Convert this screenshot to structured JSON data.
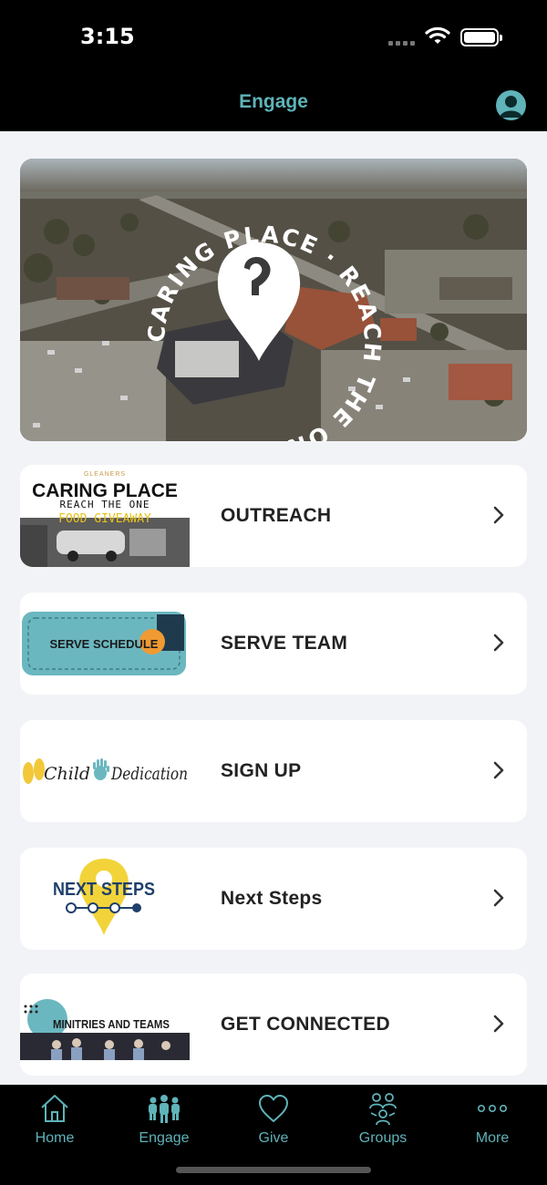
{
  "status_bar": {
    "time": "3:15"
  },
  "header": {
    "title": "Engage",
    "profile_icon": "person-circle-icon"
  },
  "hero": {
    "ring_text": "CARING PLACE · REACH THE ONE ·"
  },
  "cards": [
    {
      "label": "OUTREACH",
      "thumb": {
        "small": "GLEANERS",
        "title": "CARING PLACE",
        "subtitle": "REACH THE ONE",
        "tag": "FOOD GIVEAWAY"
      }
    },
    {
      "label": "SERVE TEAM",
      "thumb": {
        "title": "SERVE SCHEDULE"
      }
    },
    {
      "label": "SIGN UP",
      "thumb": {
        "left": "Child",
        "right": "Dedication"
      }
    },
    {
      "label": "Next Steps",
      "thumb": {
        "title": "NEXT STEPS"
      }
    },
    {
      "label": "GET CONNECTED",
      "thumb": {
        "title": "MINITRIES AND TEAMS"
      }
    }
  ],
  "tabs": [
    {
      "label": "Home",
      "icon": "house-icon"
    },
    {
      "label": "Engage",
      "icon": "people-icon"
    },
    {
      "label": "Give",
      "icon": "heart-icon"
    },
    {
      "label": "Groups",
      "icon": "groups-icon"
    },
    {
      "label": "More",
      "icon": "more-dots-icon"
    }
  ],
  "colors": {
    "accent": "#5fb3b9",
    "background": "#f2f3f7",
    "bars": "#000000"
  }
}
